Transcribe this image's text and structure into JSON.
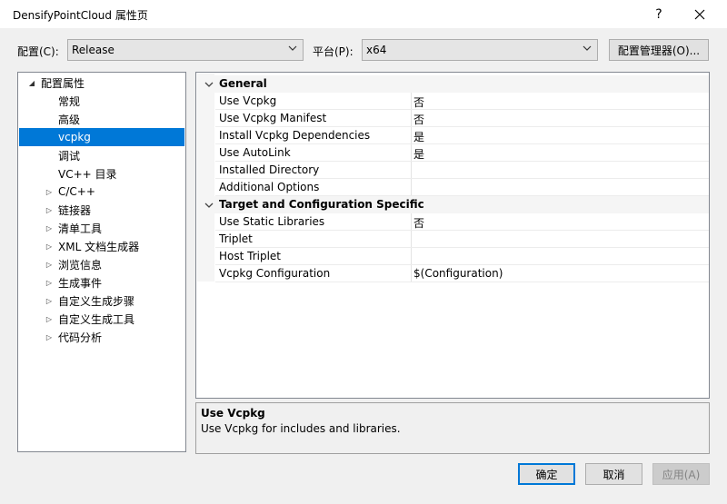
{
  "window": {
    "title": "DensifyPointCloud 属性页",
    "help_label": "?",
    "close_label": "✕"
  },
  "toolbar": {
    "config_label": "配置(C):",
    "config_value": "Release",
    "platform_label": "平台(P):",
    "platform_value": "x64",
    "config_manager_label": "配置管理器(O)..."
  },
  "tree": {
    "items": [
      {
        "label": "配置属性",
        "arrow": "expanded"
      },
      {
        "label": "常规",
        "arrow": "none"
      },
      {
        "label": "高级",
        "arrow": "none"
      },
      {
        "label": "vcpkg",
        "arrow": "none",
        "selected": true
      },
      {
        "label": "调试",
        "arrow": "none"
      },
      {
        "label": "VC++ 目录",
        "arrow": "none"
      },
      {
        "label": "C/C++",
        "arrow": "collapsed"
      },
      {
        "label": "链接器",
        "arrow": "collapsed"
      },
      {
        "label": "清单工具",
        "arrow": "collapsed"
      },
      {
        "label": "XML 文档生成器",
        "arrow": "collapsed"
      },
      {
        "label": "浏览信息",
        "arrow": "collapsed"
      },
      {
        "label": "生成事件",
        "arrow": "collapsed"
      },
      {
        "label": "自定义生成步骤",
        "arrow": "collapsed"
      },
      {
        "label": "自定义生成工具",
        "arrow": "collapsed"
      },
      {
        "label": "代码分析",
        "arrow": "collapsed"
      }
    ]
  },
  "grid": {
    "categories": [
      {
        "name": "General",
        "properties": [
          {
            "name": "Use Vcpkg",
            "value": "否"
          },
          {
            "name": "Use Vcpkg Manifest",
            "value": "否"
          },
          {
            "name": "Install Vcpkg Dependencies",
            "value": "是"
          },
          {
            "name": "Use AutoLink",
            "value": "是"
          },
          {
            "name": "Installed Directory",
            "value": ""
          },
          {
            "name": "Additional Options",
            "value": ""
          }
        ]
      },
      {
        "name": "Target and Configuration Specific",
        "properties": [
          {
            "name": "Use Static Libraries",
            "value": "否"
          },
          {
            "name": "Triplet",
            "value": ""
          },
          {
            "name": "Host Triplet",
            "value": ""
          },
          {
            "name": "Vcpkg Configuration",
            "value": "$(Configuration)"
          }
        ]
      }
    ]
  },
  "description": {
    "title": "Use Vcpkg",
    "text": "Use Vcpkg for includes and libraries."
  },
  "buttons": {
    "ok": "确定",
    "cancel": "取消",
    "apply": "应用(A)"
  }
}
